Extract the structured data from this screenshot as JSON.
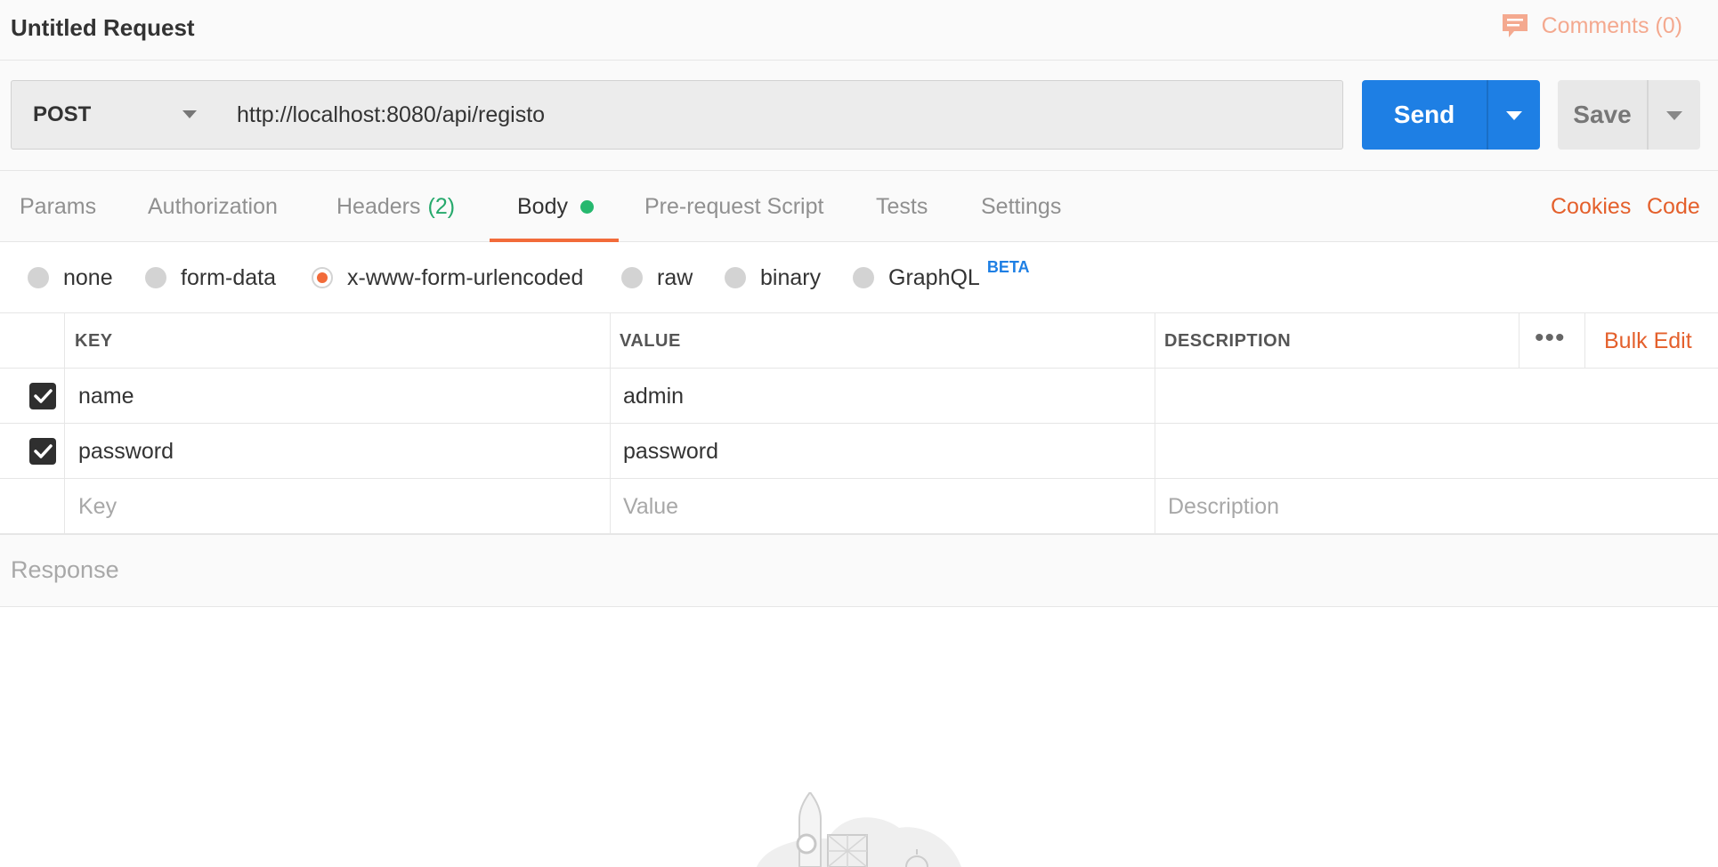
{
  "header": {
    "title": "Untitled Request",
    "comments_label": "Comments (0)"
  },
  "request": {
    "method": "POST",
    "url": "http://localhost:8080/api/registo",
    "send_label": "Send",
    "save_label": "Save"
  },
  "tabs": [
    {
      "label": "Params"
    },
    {
      "label": "Authorization"
    },
    {
      "label": "Headers",
      "count": "(2)"
    },
    {
      "label": "Body",
      "active": true
    },
    {
      "label": "Pre-request Script"
    },
    {
      "label": "Tests"
    },
    {
      "label": "Settings"
    }
  ],
  "links": {
    "cookies": "Cookies",
    "code": "Code"
  },
  "body_types": [
    {
      "label": "none"
    },
    {
      "label": "form-data"
    },
    {
      "label": "x-www-form-urlencoded",
      "selected": true
    },
    {
      "label": "raw"
    },
    {
      "label": "binary"
    },
    {
      "label": "GraphQL",
      "badge": "BETA"
    }
  ],
  "table": {
    "columns": [
      "KEY",
      "VALUE",
      "DESCRIPTION"
    ],
    "bulk_edit": "Bulk Edit",
    "rows": [
      {
        "checked": true,
        "key": "name",
        "value": "admin",
        "description": ""
      },
      {
        "checked": true,
        "key": "password",
        "value": "password",
        "description": ""
      }
    ],
    "placeholders": {
      "key": "Key",
      "value": "Value",
      "description": "Description"
    }
  },
  "response": {
    "label": "Response"
  },
  "colors": {
    "send_blue": "#1e7fe4",
    "accent_orange": "#f26b3a",
    "link_orange": "#e4602c",
    "dot_green": "#26b86e"
  }
}
